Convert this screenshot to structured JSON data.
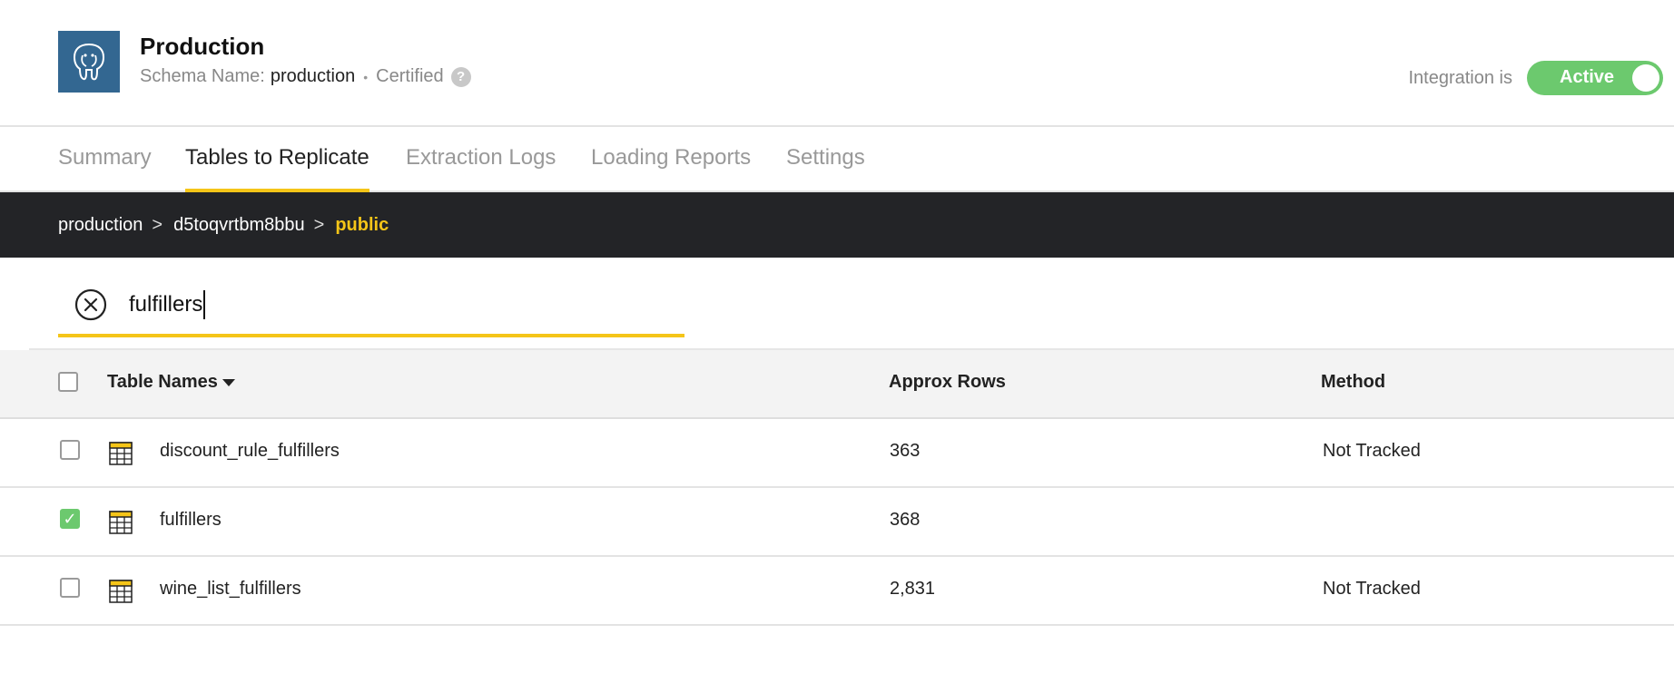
{
  "header": {
    "title": "Production",
    "schema_label": "Schema Name:",
    "schema_value": "production",
    "separator": "•",
    "certified": "Certified",
    "help": "?",
    "integration_label": "Integration is",
    "integration_status": "Active",
    "integration_active": true
  },
  "tabs": [
    {
      "label": "Summary",
      "active": false
    },
    {
      "label": "Tables to Replicate",
      "active": true
    },
    {
      "label": "Extraction Logs",
      "active": false
    },
    {
      "label": "Loading Reports",
      "active": false
    },
    {
      "label": "Settings",
      "active": false
    }
  ],
  "breadcrumb": {
    "items": [
      "production",
      "d5toqvrtbm8bbu"
    ],
    "separator": ">",
    "current": "public"
  },
  "search": {
    "value": "fulfillers"
  },
  "table": {
    "columns": {
      "name": "Table Names",
      "rows": "Approx Rows",
      "method": "Method"
    },
    "rows": [
      {
        "name": "discount_rule_fulfillers",
        "rows": "363",
        "method": "Not Tracked",
        "checked": false
      },
      {
        "name": "fulfillers",
        "rows": "368",
        "method": "",
        "checked": true
      },
      {
        "name": "wine_list_fulfillers",
        "rows": "2,831",
        "method": "Not Tracked",
        "checked": false
      }
    ]
  },
  "colors": {
    "accent": "#f5c518",
    "active_green": "#6cc96e",
    "breadcrumb_bg": "#232427",
    "logo_bg": "#336791"
  },
  "icons": {
    "logo": "postgresql-elephant-icon",
    "clear": "clear-circle-x-icon",
    "table": "table-grid-icon",
    "help": "help-question-icon",
    "sort": "caret-down-icon"
  }
}
